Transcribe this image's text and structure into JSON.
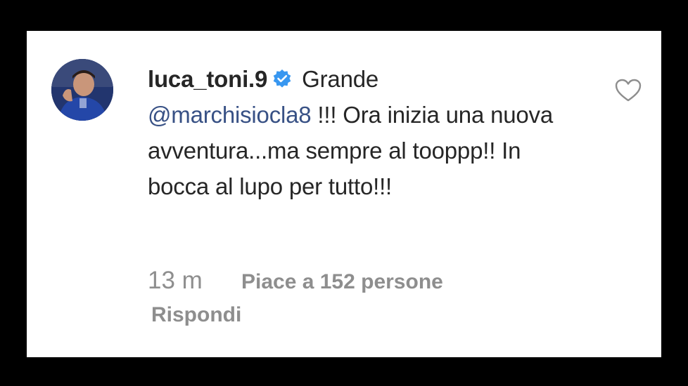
{
  "comment": {
    "username": "luca_toni.9",
    "verified_icon": "verified-badge-icon",
    "text_before_mention": "Grande",
    "mention": "@marchisiocla8",
    "text_after_mention": "!!! Ora inizia una nuova avventura...ma sempre al tooppp!! In bocca al lupo per tutto!!!",
    "time": "13 m",
    "likes": "Piace a 152 persone",
    "reply": "Rispondi",
    "like_icon": "heart-outline-icon"
  },
  "colors": {
    "background": "#000000",
    "card": "#ffffff",
    "text": "#262626",
    "mention": "#385185",
    "secondary": "#8e8e8e",
    "verified": "#3897f0"
  }
}
